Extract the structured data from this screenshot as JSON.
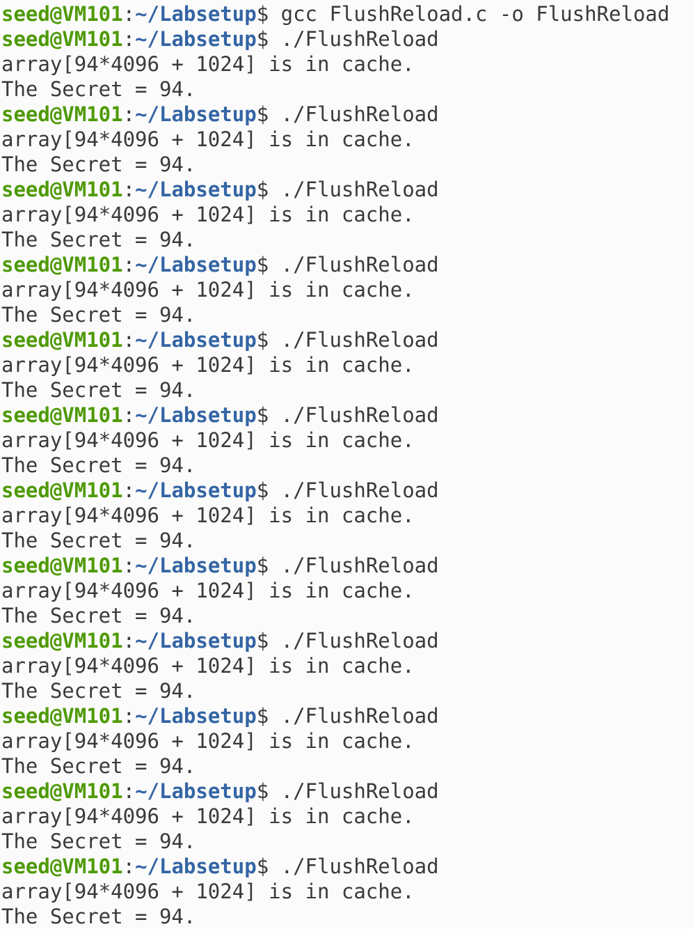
{
  "terminal": {
    "prompt": {
      "user_host": "seed@VM101",
      "separator": ":",
      "cwd": "~/Labsetup",
      "symbol": "$"
    },
    "colors": {
      "user_host": "#4e9a06",
      "cwd": "#3465a4",
      "text": "#3a3a3a",
      "background": "#fbfbfb"
    },
    "lines": [
      {
        "type": "prompt",
        "command": " gcc FlushReload.c -o FlushReload"
      },
      {
        "type": "prompt",
        "command": " ./FlushReload"
      },
      {
        "type": "output",
        "text": "array[94*4096 + 1024] is in cache."
      },
      {
        "type": "output",
        "text": "The Secret = 94."
      },
      {
        "type": "prompt",
        "command": " ./FlushReload"
      },
      {
        "type": "output",
        "text": "array[94*4096 + 1024] is in cache."
      },
      {
        "type": "output",
        "text": "The Secret = 94."
      },
      {
        "type": "prompt",
        "command": " ./FlushReload"
      },
      {
        "type": "output",
        "text": "array[94*4096 + 1024] is in cache."
      },
      {
        "type": "output",
        "text": "The Secret = 94."
      },
      {
        "type": "prompt",
        "command": " ./FlushReload"
      },
      {
        "type": "output",
        "text": "array[94*4096 + 1024] is in cache."
      },
      {
        "type": "output",
        "text": "The Secret = 94."
      },
      {
        "type": "prompt",
        "command": " ./FlushReload"
      },
      {
        "type": "output",
        "text": "array[94*4096 + 1024] is in cache."
      },
      {
        "type": "output",
        "text": "The Secret = 94."
      },
      {
        "type": "prompt",
        "command": " ./FlushReload"
      },
      {
        "type": "output",
        "text": "array[94*4096 + 1024] is in cache."
      },
      {
        "type": "output",
        "text": "The Secret = 94."
      },
      {
        "type": "prompt",
        "command": " ./FlushReload"
      },
      {
        "type": "output",
        "text": "array[94*4096 + 1024] is in cache."
      },
      {
        "type": "output",
        "text": "The Secret = 94."
      },
      {
        "type": "prompt",
        "command": " ./FlushReload"
      },
      {
        "type": "output",
        "text": "array[94*4096 + 1024] is in cache."
      },
      {
        "type": "output",
        "text": "The Secret = 94."
      },
      {
        "type": "prompt",
        "command": " ./FlushReload"
      },
      {
        "type": "output",
        "text": "array[94*4096 + 1024] is in cache."
      },
      {
        "type": "output",
        "text": "The Secret = 94."
      },
      {
        "type": "prompt",
        "command": " ./FlushReload"
      },
      {
        "type": "output",
        "text": "array[94*4096 + 1024] is in cache."
      },
      {
        "type": "output",
        "text": "The Secret = 94."
      },
      {
        "type": "prompt",
        "command": " ./FlushReload"
      },
      {
        "type": "output",
        "text": "array[94*4096 + 1024] is in cache."
      },
      {
        "type": "output",
        "text": "The Secret = 94."
      },
      {
        "type": "prompt",
        "command": " ./FlushReload"
      },
      {
        "type": "output",
        "text": "array[94*4096 + 1024] is in cache."
      },
      {
        "type": "output",
        "text": "The Secret = 94."
      }
    ]
  }
}
